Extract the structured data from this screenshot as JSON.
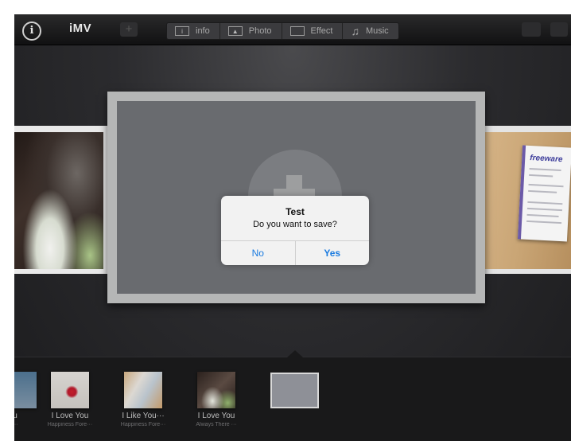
{
  "toolbar": {
    "info_icon": "i",
    "app_title": "iMV",
    "tabs": [
      {
        "label": "info",
        "icon": "info-icon"
      },
      {
        "label": "Photo",
        "icon": "photo-icon"
      },
      {
        "label": "Effect",
        "icon": "effect-icon"
      },
      {
        "label": "Music",
        "icon": "music-note-icon"
      }
    ]
  },
  "right_card": {
    "doc_logo": "freeware"
  },
  "dialog": {
    "title": "Test",
    "message": "Do you want to save?",
    "no_label": "No",
    "yes_label": "Yes",
    "button_color": "#1a7be0"
  },
  "timeline": {
    "items": [
      {
        "title": "u",
        "subtitle": "···"
      },
      {
        "title": "I Love You",
        "subtitle": "Happiness Fore···"
      },
      {
        "title": "I Like You···",
        "subtitle": "Happiness Fore···"
      },
      {
        "title": "I Love You",
        "subtitle": "Always There ···"
      }
    ]
  }
}
